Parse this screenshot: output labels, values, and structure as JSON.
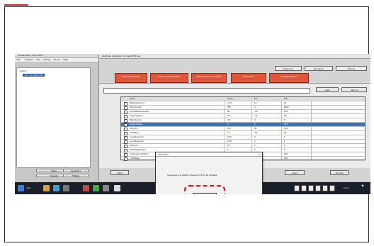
{
  "window": {
    "title": "Tekniskt data - Volvo VIDA",
    "app_title": "Elektriska kopplingar / Kontakt ECM Hud",
    "menu": [
      "Arkiv",
      "Redigera",
      "Visa",
      "Verktyg",
      "Fönster",
      "Hjälp"
    ]
  },
  "left_panel": {
    "nodes": [
      {
        "label": "Fordon",
        "selected": false
      },
      {
        "label": "ANP 700 0000 0392",
        "selected": true
      }
    ],
    "buttons": [
      "Stäng",
      "Uppdatera",
      "Visa alla",
      "Tillbaka"
    ]
  },
  "top_buttons": [
    "Diagnostik",
    "Mitt arbete",
    "Mätinstr"
  ],
  "tabs": [
    "Fordonsinformation",
    "Avläsa / Radera felkoder",
    "Aktivering av komponenter",
    "Parametrar",
    "Driftlägesdiagnos"
  ],
  "right_buttons": [
    "Hjälp",
    "Skriv ut"
  ],
  "table": {
    "headers": [
      "Namn",
      "Värde",
      "Min",
      "Max"
    ],
    "rows": [
      [
        "Batterispänning",
        "12.5",
        "10",
        "15"
      ],
      [
        "Motorvarvtal",
        "800",
        "0",
        "8000"
      ],
      [
        "Kylvätsketemperatur",
        "88",
        "-40",
        "130"
      ],
      [
        "Insugningsluft",
        "25",
        "-40",
        "80"
      ],
      [
        "Bränsletryck",
        "3.8",
        "0",
        "6"
      ],
      [
        "Gaspedalläge",
        "0",
        "0",
        "100"
      ],
      [
        "Lufttryck",
        "101",
        "50",
        "120"
      ],
      [
        "Tändläge",
        "10",
        "-20",
        "50"
      ],
      [
        "Lambdasond 1",
        "0.45",
        "0",
        "1"
      ],
      [
        "Lambdasond 2",
        "0.45",
        "0",
        "1"
      ],
      [
        "Oljetryck",
        "2.5",
        "0",
        "8"
      ],
      [
        "Växellägesgivare",
        "1",
        "0",
        "6"
      ],
      [
        "Fordonets hastighet",
        "0",
        "0",
        "250"
      ],
      [
        "Trottelläge",
        "4",
        "0",
        "100"
      ]
    ],
    "highlighted_row": 5
  },
  "bottom_buttons": [
    "Starta",
    "Stopp",
    "Spara",
    "Återställ"
  ],
  "dialog": {
    "title": "Information",
    "message": "Operationen är slutförd. Klicka på OK för att fortsätta.",
    "ok_label": "OK"
  },
  "taskbar": {
    "start_text": "Start",
    "status_text": "Fordonet är anslutet till VIDA",
    "clock": "10:42"
  },
  "colors": {
    "tab_red": "#e2553a",
    "highlight_blue": "#3b73c4",
    "annotation_red": "#e01010",
    "taskbar": "#1b1f2a"
  }
}
